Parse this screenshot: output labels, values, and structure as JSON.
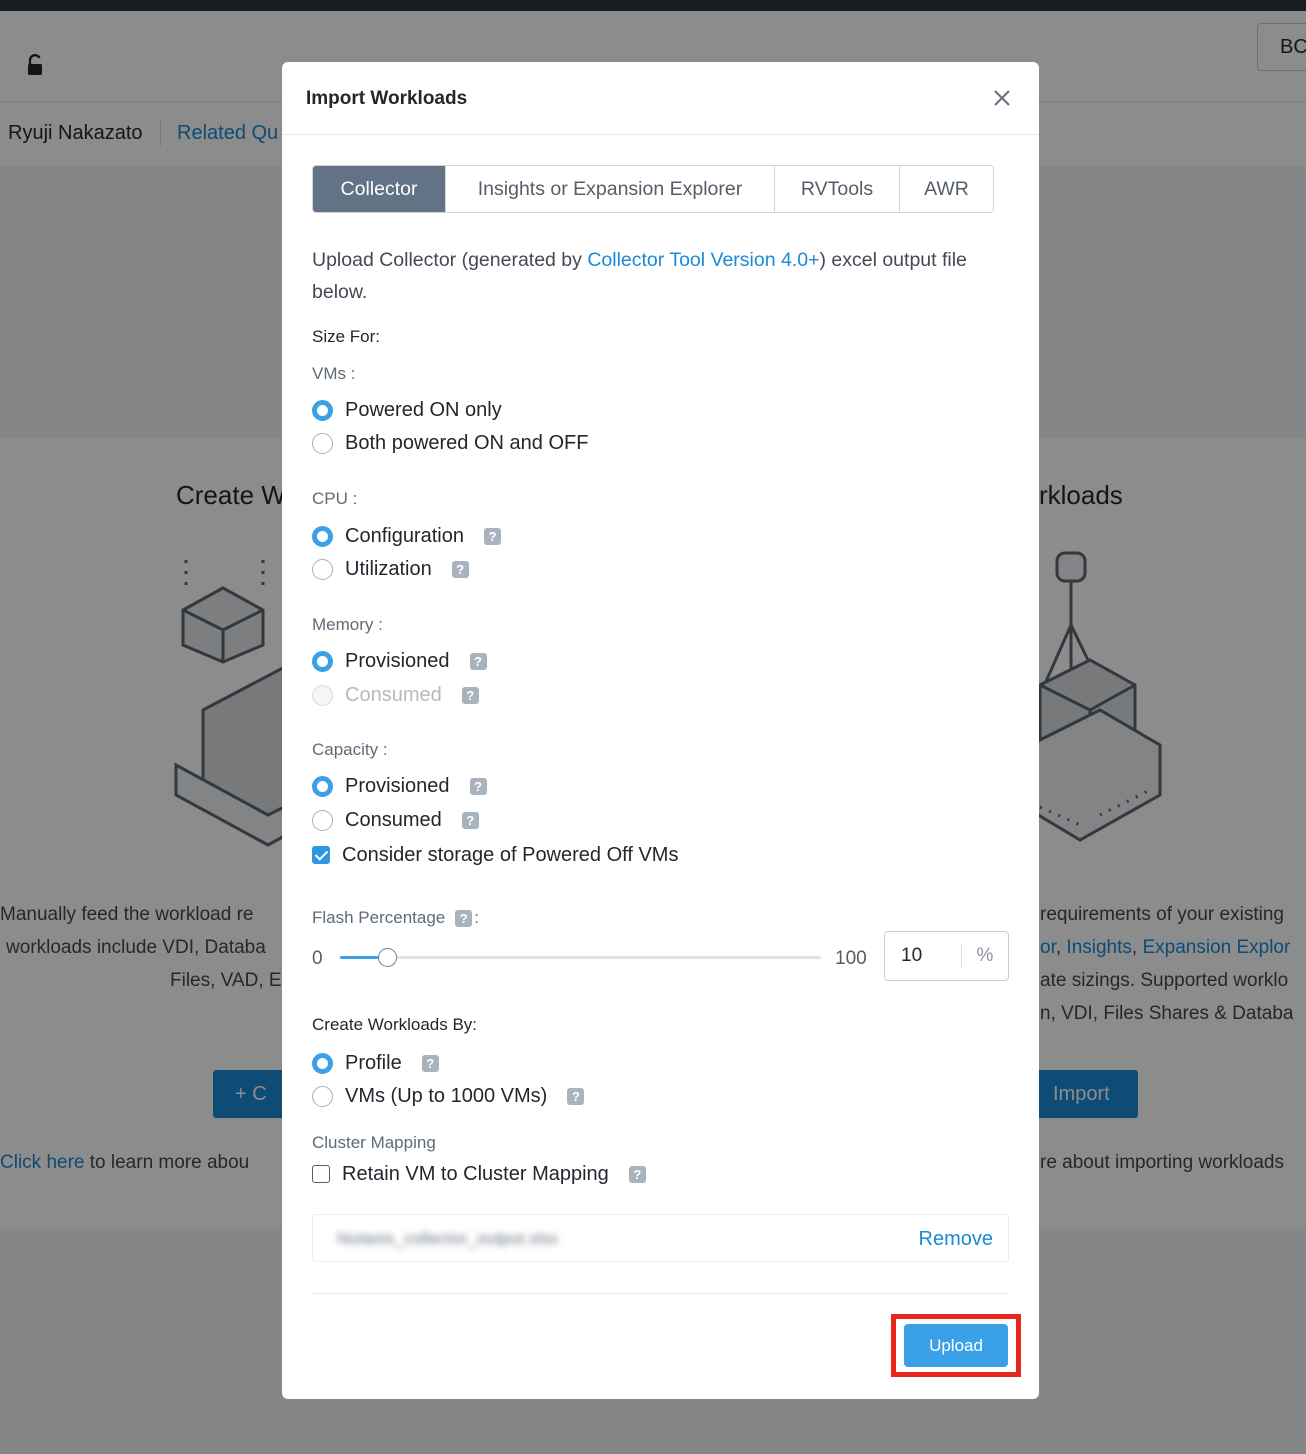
{
  "header": {
    "button_label": "BC"
  },
  "subbar": {
    "user_name": "Ryuji Nakazato",
    "related_link": "Related Qu"
  },
  "background": {
    "left_card": {
      "title": "Create W",
      "desc_lines": [
        "Manually feed the workload re",
        "workloads include VDI, Databa",
        "Files, VAD, E"
      ],
      "button_label": "+  C",
      "click_here": "Click here",
      "click_rest": "  to learn more abou"
    },
    "right_card": {
      "title": ": Workloads",
      "desc_line1": "requirements of your existing",
      "desc_line2_links": [
        "or",
        "Insights",
        "Expansion Explor"
      ],
      "desc_line3": "ate sizings. Supported worklo",
      "desc_line4": "n, VDI, Files Shares & Databa",
      "button_label": "Import",
      "click_rest": "re about importing workloads"
    }
  },
  "modal": {
    "title": "Import Workloads",
    "tabs": [
      {
        "label": "Collector",
        "active": true
      },
      {
        "label": "Insights or Expansion Explorer",
        "active": false
      },
      {
        "label": "RVTools",
        "active": false
      },
      {
        "label": "AWR",
        "active": false
      }
    ],
    "intro": {
      "before": "Upload Collector (generated by ",
      "link": "Collector Tool Version 4.0+",
      "after": ") excel output file below."
    },
    "size_for": "Size For:",
    "vms": {
      "label": "VMs :",
      "options": [
        {
          "label": "Powered ON only",
          "selected": true
        },
        {
          "label": "Both powered ON and OFF",
          "selected": false
        }
      ]
    },
    "cpu": {
      "label": "CPU :",
      "options": [
        {
          "label": "Configuration",
          "selected": true
        },
        {
          "label": "Utilization",
          "selected": false
        }
      ]
    },
    "memory": {
      "label": "Memory :",
      "options": [
        {
          "label": "Provisioned",
          "selected": true
        },
        {
          "label": "Consumed",
          "selected": false,
          "disabled": true
        }
      ]
    },
    "capacity": {
      "label": "Capacity :",
      "options": [
        {
          "label": "Provisioned",
          "selected": true
        },
        {
          "label": "Consumed",
          "selected": false
        }
      ],
      "storage_checkbox": {
        "label": "Consider storage of Powered Off VMs",
        "checked": true
      }
    },
    "flash": {
      "label": "Flash Percentage",
      "colon": ":",
      "min": "0",
      "max": "100",
      "value": "10",
      "unit": "%",
      "fraction": 0.1
    },
    "create_by": {
      "label": "Create Workloads By:",
      "options": [
        {
          "label": "Profile",
          "selected": true
        },
        {
          "label": "VMs (Up to 1000 VMs)",
          "selected": false
        }
      ]
    },
    "cluster_mapping": {
      "label": "Cluster Mapping",
      "checkbox": {
        "label": "Retain VM to Cluster Mapping",
        "checked": false
      }
    },
    "file": {
      "name": "Nutanix_collector_output.xlsx",
      "remove_label": "Remove"
    },
    "upload_label": "Upload",
    "help_glyph": "?",
    "colors": {
      "accent": "#3aa0e8",
      "active_tab": "#627385",
      "link": "#1b8ad6",
      "highlight": "#e8251a"
    }
  }
}
